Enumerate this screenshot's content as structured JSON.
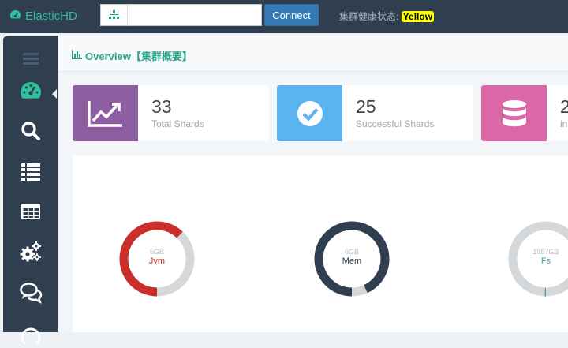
{
  "app": {
    "title": "ElasticHD"
  },
  "topbar": {
    "url_value": "",
    "connect_label": "Connect",
    "health_label": "集群健康状态:",
    "health_value": "Yellow"
  },
  "sidebar": {
    "items": [
      {
        "icon": "menu-icon"
      },
      {
        "icon": "dashboard-icon",
        "active": true
      },
      {
        "icon": "search-icon"
      },
      {
        "icon": "list-icon"
      },
      {
        "icon": "table-icon"
      },
      {
        "icon": "gears-icon"
      },
      {
        "icon": "comments-icon"
      },
      {
        "icon": "info-icon"
      }
    ]
  },
  "header": {
    "title": "Overview【集群概要】"
  },
  "stats": [
    {
      "value": "33",
      "label": "Total Shards",
      "color": "#8e5ea2",
      "icon": "line-chart-icon"
    },
    {
      "value": "25",
      "label": "Successful Shards",
      "color": "#5bb3f0",
      "icon": "check-circle-icon"
    },
    {
      "value": "2",
      "label": "in",
      "color": "#dc67a8",
      "icon": "database-icon"
    }
  ],
  "gauges": [
    {
      "size": "6GB",
      "name": "Jvm",
      "used_fraction": 0.62,
      "color": "#c9302c",
      "track": "#d5d8da",
      "name_color": "#c9302c"
    },
    {
      "size": "6GB",
      "name": "Mem",
      "used_fraction": 0.93,
      "color": "#2f3f4f",
      "track": "#d5d8da",
      "name_color": "#2f3f4f"
    },
    {
      "size": "1957GB",
      "name": "Fs",
      "used_fraction": 0.005,
      "color": "#5a9aa0",
      "track": "#d5d8da",
      "name_color": "#4aa3b5"
    }
  ]
}
